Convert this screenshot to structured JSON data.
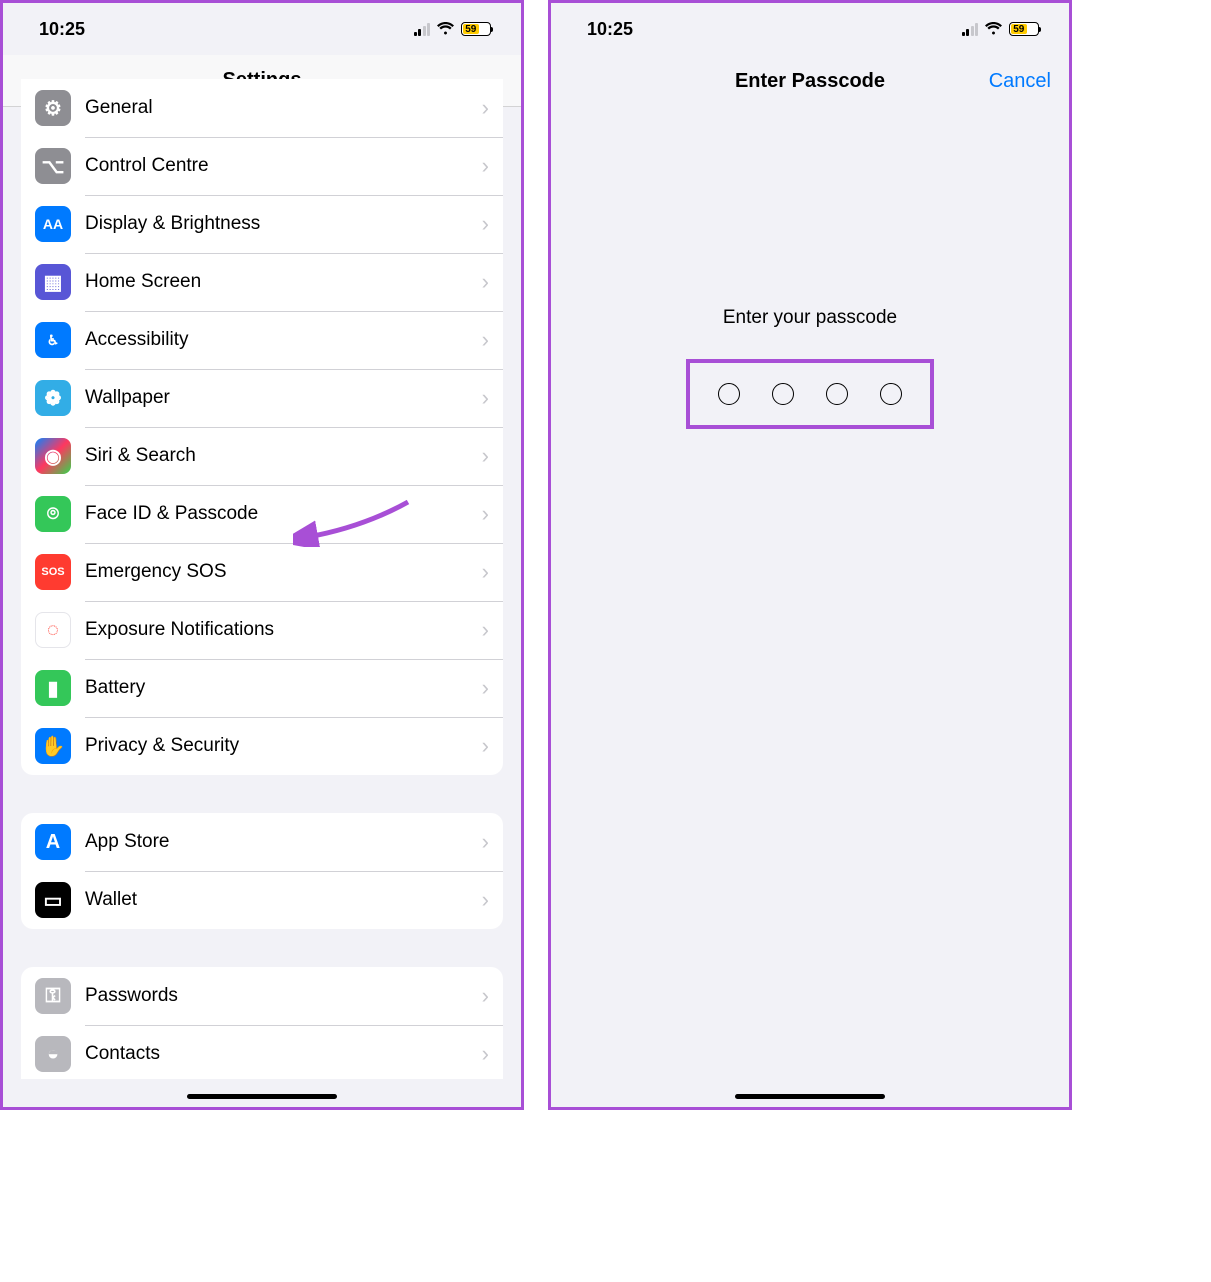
{
  "status": {
    "time": "10:25",
    "battery": "59"
  },
  "left": {
    "title": "Settings",
    "groups": [
      {
        "id": "group1",
        "items": [
          {
            "id": "general",
            "label": "General",
            "icon": "gear-icon",
            "bg": "bg-gray",
            "glyph": "⚙"
          },
          {
            "id": "control-centre",
            "label": "Control Centre",
            "icon": "toggles-icon",
            "bg": "bg-gray",
            "glyph": "⌥"
          },
          {
            "id": "display-brightness",
            "label": "Display & Brightness",
            "icon": "text-size-icon",
            "bg": "bg-blue",
            "glyph": "AA"
          },
          {
            "id": "home-screen",
            "label": "Home Screen",
            "icon": "grid-icon",
            "bg": "bg-indigo",
            "glyph": "▦"
          },
          {
            "id": "accessibility",
            "label": "Accessibility",
            "icon": "accessibility-icon",
            "bg": "bg-blue",
            "glyph": "♿︎"
          },
          {
            "id": "wallpaper",
            "label": "Wallpaper",
            "icon": "flower-icon",
            "bg": "bg-cyan",
            "glyph": "❁"
          },
          {
            "id": "siri-search",
            "label": "Siri & Search",
            "icon": "siri-icon",
            "bg": "bg-siri",
            "glyph": "◉"
          },
          {
            "id": "faceid-passcode",
            "label": "Face ID & Passcode",
            "icon": "faceid-icon",
            "bg": "bg-green",
            "glyph": "⌾"
          },
          {
            "id": "emergency-sos",
            "label": "Emergency SOS",
            "icon": "sos-icon",
            "bg": "bg-red",
            "glyph": "SOS"
          },
          {
            "id": "exposure-notifications",
            "label": "Exposure Notifications",
            "icon": "exposure-icon",
            "bg": "bg-white",
            "glyph": "◌"
          },
          {
            "id": "battery",
            "label": "Battery",
            "icon": "battery-icon",
            "bg": "bg-green",
            "glyph": "▮"
          },
          {
            "id": "privacy-security",
            "label": "Privacy & Security",
            "icon": "hand-icon",
            "bg": "bg-blue",
            "glyph": "✋"
          }
        ]
      },
      {
        "id": "group2",
        "items": [
          {
            "id": "app-store",
            "label": "App Store",
            "icon": "appstore-icon",
            "bg": "bg-blue",
            "glyph": "A"
          },
          {
            "id": "wallet",
            "label": "Wallet",
            "icon": "wallet-icon",
            "bg": "bg-black",
            "glyph": "▭"
          }
        ]
      },
      {
        "id": "group3",
        "items": [
          {
            "id": "passwords",
            "label": "Passwords",
            "icon": "key-icon",
            "bg": "bg-lgray",
            "glyph": "⚿"
          },
          {
            "id": "contacts",
            "label": "Contacts",
            "icon": "contacts-icon",
            "bg": "bg-lgray",
            "glyph": "◒"
          }
        ]
      }
    ]
  },
  "right": {
    "title": "Enter Passcode",
    "cancel": "Cancel",
    "prompt": "Enter your passcode",
    "digits": 4
  },
  "annotation": {
    "arrow_target": "faceid-passcode",
    "highlight_box": "passcode-dots"
  }
}
